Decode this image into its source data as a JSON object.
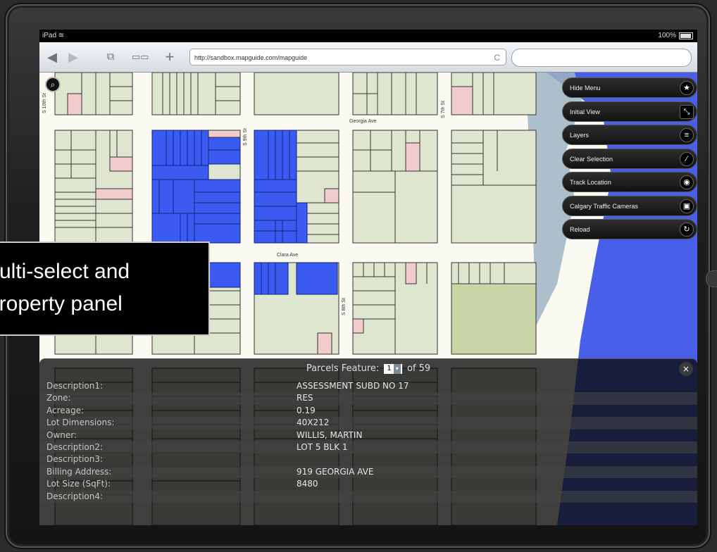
{
  "status_bar": {
    "device": "iPad",
    "wifi_icon": "wifi-icon",
    "battery_text": "100%"
  },
  "browser": {
    "back_icon": "◀",
    "forward_icon": "▶",
    "tabs_icon": "⧉",
    "bookmarks_icon": "📖",
    "add_icon": "+",
    "url": "http://sandbox.mapguide.com/mapguide",
    "reload_icon": "C",
    "search_placeholder": ""
  },
  "map": {
    "street_labels": {
      "georgia": "Georgia Ave",
      "clara": "Clara Ave",
      "s_10th": "S 10th St",
      "s_9th": "S 9th St",
      "s_8th": "S 8th St",
      "s_7th": "S 7th St"
    },
    "colors": {
      "parcel": "#dfe6cf",
      "selected": "#3b5bf0",
      "water": "#4a5fe8",
      "street": "#fbfaf2",
      "pink": "#f2cccc",
      "park": "#c9d5a6"
    }
  },
  "menu": {
    "items": [
      {
        "label": "Hide Menu",
        "icon": "★"
      },
      {
        "label": "Initial View",
        "icon": "⤡"
      },
      {
        "label": "Layers",
        "icon": "≡"
      },
      {
        "label": "Clear Selection",
        "icon": "∕"
      },
      {
        "label": "Track Location",
        "icon": "◉"
      },
      {
        "label": "Calgary Traffic Cameras",
        "icon": "▣"
      },
      {
        "label": "Reload",
        "icon": "↻"
      }
    ]
  },
  "caption": {
    "line1": "Multi-select and",
    "line2": "property panel"
  },
  "panel": {
    "title_prefix": "Parcels Feature:",
    "selected_index": "1",
    "title_suffix": "of 59",
    "close_icon": "×",
    "rows": [
      {
        "name": "Description1:",
        "value": "ASSESSMENT SUBD NO 17"
      },
      {
        "name": "Zone:",
        "value": "RES"
      },
      {
        "name": "Acreage:",
        "value": "0.19"
      },
      {
        "name": "Lot Dimensions:",
        "value": "40X212"
      },
      {
        "name": "Owner:",
        "value": "WILLIS, MARTIN"
      },
      {
        "name": "Description2:",
        "value": "LOT 5 BLK 1"
      },
      {
        "name": "Description3:",
        "value": ""
      },
      {
        "name": "Billing Address:",
        "value": "919 GEORGIA AVE"
      },
      {
        "name": "Lot Size (SqFt):",
        "value": "8480"
      },
      {
        "name": "Description4:",
        "value": ""
      }
    ]
  }
}
